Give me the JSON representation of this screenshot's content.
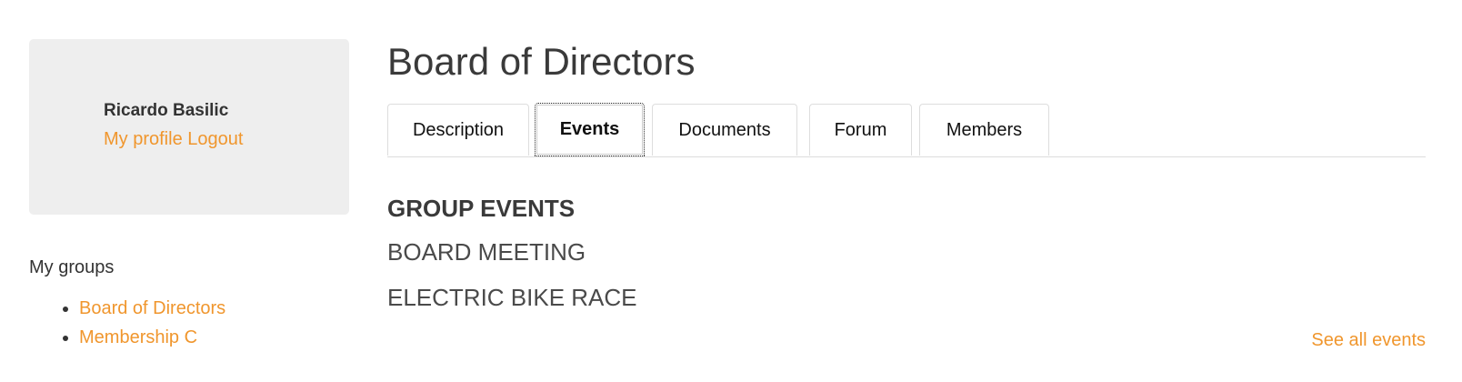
{
  "sidebar": {
    "profile": {
      "name": "Ricardo Basilic",
      "my_profile_label": "My profile",
      "logout_label": "Logout"
    },
    "groups_heading": "My groups",
    "groups": [
      {
        "label": "Board of Directors"
      },
      {
        "label": "Membership C"
      }
    ]
  },
  "main": {
    "title": "Board of Directors",
    "tabs": [
      {
        "label": "Description",
        "active": false
      },
      {
        "label": "Events",
        "active": true
      },
      {
        "label": "Documents",
        "active": false
      },
      {
        "label": "Forum",
        "active": false
      },
      {
        "label": "Members",
        "active": false
      }
    ],
    "section_heading": "GROUP EVENTS",
    "events": [
      {
        "label": "BOARD MEETING"
      },
      {
        "label": "ELECTRIC BIKE RACE"
      }
    ],
    "see_all_label": "See all events"
  },
  "colors": {
    "link": "#f0962d",
    "card_background": "#eeeeee",
    "text": "#333333"
  }
}
